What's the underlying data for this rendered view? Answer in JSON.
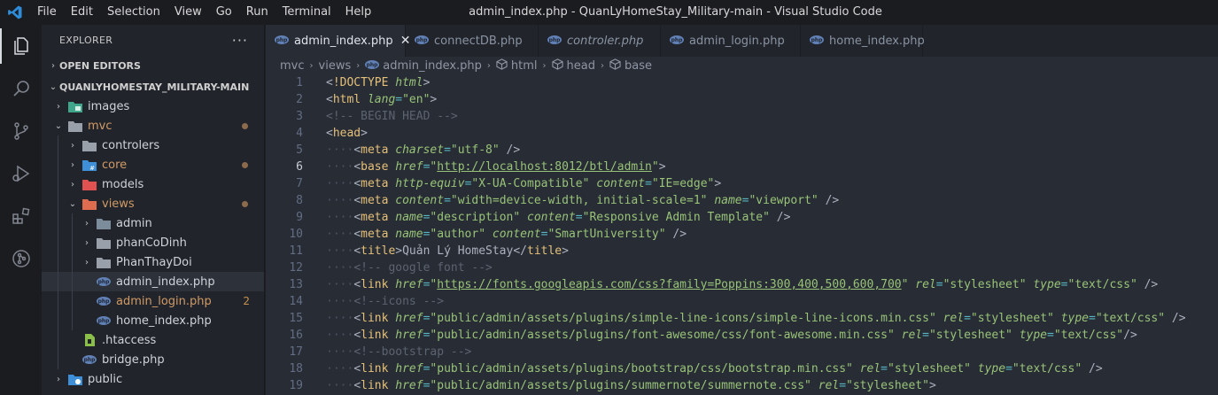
{
  "titlebar": {
    "menu": [
      "File",
      "Edit",
      "Selection",
      "View",
      "Go",
      "Run",
      "Terminal",
      "Help"
    ],
    "title": "admin_index.php - QuanLyHomeStay_Military-main - Visual Studio Code"
  },
  "activitybar": [
    "explorer-icon",
    "search-icon",
    "source-control-icon",
    "run-debug-icon",
    "extensions-icon",
    "git-graph-icon"
  ],
  "sidebar": {
    "title": "EXPLORER",
    "more": "···",
    "open_editors": "OPEN EDITORS",
    "root": "QUANLYHOMESTAY_MILITARY-MAIN",
    "tree": [
      {
        "label": "images",
        "type": "folder-images",
        "depth": 0,
        "chev": "›"
      },
      {
        "label": "mvc",
        "type": "folder-open",
        "depth": 0,
        "chev": "⌄",
        "status": "dot"
      },
      {
        "label": "controlers",
        "type": "folder",
        "depth": 1,
        "chev": "›"
      },
      {
        "label": "core",
        "type": "folder-core",
        "depth": 1,
        "chev": "›",
        "status": "dot"
      },
      {
        "label": "models",
        "type": "folder-models",
        "depth": 1,
        "chev": "›"
      },
      {
        "label": "views",
        "type": "folder-views",
        "depth": 1,
        "chev": "⌄",
        "status": "dot"
      },
      {
        "label": "admin",
        "type": "folder-admin",
        "depth": 2,
        "chev": "›"
      },
      {
        "label": "phanCoDinh",
        "type": "folder",
        "depth": 2,
        "chev": "›"
      },
      {
        "label": "PhanThayDoi",
        "type": "folder",
        "depth": 2,
        "chev": "›"
      },
      {
        "label": "admin_index.php",
        "type": "php",
        "depth": 2,
        "chev": "",
        "selected": true
      },
      {
        "label": "admin_login.php",
        "type": "php",
        "depth": 2,
        "chev": "",
        "status": "2"
      },
      {
        "label": "home_index.php",
        "type": "php",
        "depth": 2,
        "chev": "",
        "dim": true
      },
      {
        "label": ".htaccess",
        "type": "htaccess",
        "depth": 1,
        "chev": ""
      },
      {
        "label": "bridge.php",
        "type": "php",
        "depth": 1,
        "chev": ""
      },
      {
        "label": "public",
        "type": "folder-public",
        "depth": 0,
        "chev": "›"
      }
    ]
  },
  "tabs": [
    {
      "label": "admin_index.php",
      "active": true,
      "close": "✕"
    },
    {
      "label": "connectDB.php"
    },
    {
      "label": "controler.php",
      "italic": true
    },
    {
      "label": "admin_login.php"
    },
    {
      "label": "home_index.php"
    }
  ],
  "breadcrumb": [
    "mvc",
    "views",
    "admin_index.php",
    "html",
    "head",
    "base"
  ],
  "code": [
    {
      "n": "1",
      "tokens": [
        [
          "pct",
          "<"
        ],
        [
          "dt",
          "!DOCTYPE"
        ],
        [
          "pct",
          " "
        ],
        [
          "attr",
          "html"
        ],
        [
          "pct",
          ">"
        ]
      ]
    },
    {
      "n": "2",
      "tokens": [
        [
          "pct",
          "<"
        ],
        [
          "tag",
          "html"
        ],
        [
          "pct",
          " "
        ],
        [
          "attr",
          "lang"
        ],
        [
          "eq",
          "="
        ],
        [
          "str",
          "\"en\""
        ],
        [
          "pct",
          ">"
        ]
      ]
    },
    {
      "n": "3",
      "tokens": [
        [
          "com",
          "<!-- BEGIN HEAD -->"
        ]
      ]
    },
    {
      "n": "4",
      "tokens": [
        [
          "pct",
          "<"
        ],
        [
          "tag",
          "head"
        ],
        [
          "pct",
          ">"
        ]
      ]
    },
    {
      "n": "5",
      "indent": 1,
      "tokens": [
        [
          "pct",
          "<"
        ],
        [
          "tag",
          "meta"
        ],
        [
          "pct",
          " "
        ],
        [
          "attr",
          "charset"
        ],
        [
          "eq",
          "="
        ],
        [
          "str",
          "\"utf-8\""
        ],
        [
          "pct",
          " />"
        ]
      ]
    },
    {
      "n": "6",
      "indent": 1,
      "cur": true,
      "tokens": [
        [
          "pct",
          "<"
        ],
        [
          "tag",
          "base"
        ],
        [
          "pct",
          " "
        ],
        [
          "attr",
          "href"
        ],
        [
          "eq",
          "="
        ],
        [
          "str",
          "\""
        ],
        [
          "url",
          "http://localhost:8012/btl/admin"
        ],
        [
          "str",
          "\""
        ],
        [
          "pct",
          ">"
        ]
      ]
    },
    {
      "n": "7",
      "indent": 1,
      "tokens": [
        [
          "pct",
          "<"
        ],
        [
          "tag",
          "meta"
        ],
        [
          "pct",
          " "
        ],
        [
          "attr",
          "http-equiv"
        ],
        [
          "eq",
          "="
        ],
        [
          "str",
          "\"X-UA-Compatible\""
        ],
        [
          "pct",
          " "
        ],
        [
          "attr",
          "content"
        ],
        [
          "eq",
          "="
        ],
        [
          "str",
          "\"IE=edge\""
        ],
        [
          "pct",
          ">"
        ]
      ]
    },
    {
      "n": "8",
      "indent": 1,
      "tokens": [
        [
          "pct",
          "<"
        ],
        [
          "tag",
          "meta"
        ],
        [
          "pct",
          " "
        ],
        [
          "attr",
          "content"
        ],
        [
          "eq",
          "="
        ],
        [
          "str",
          "\"width=device-width, initial-scale=1\""
        ],
        [
          "pct",
          " "
        ],
        [
          "attr",
          "name"
        ],
        [
          "eq",
          "="
        ],
        [
          "str",
          "\"viewport\""
        ],
        [
          "pct",
          " />"
        ]
      ]
    },
    {
      "n": "9",
      "indent": 1,
      "tokens": [
        [
          "pct",
          "<"
        ],
        [
          "tag",
          "meta"
        ],
        [
          "pct",
          " "
        ],
        [
          "attr",
          "name"
        ],
        [
          "eq",
          "="
        ],
        [
          "str",
          "\"description\""
        ],
        [
          "pct",
          " "
        ],
        [
          "attr",
          "content"
        ],
        [
          "eq",
          "="
        ],
        [
          "str",
          "\"Responsive Admin Template\""
        ],
        [
          "pct",
          " />"
        ]
      ]
    },
    {
      "n": "10",
      "indent": 1,
      "tokens": [
        [
          "pct",
          "<"
        ],
        [
          "tag",
          "meta"
        ],
        [
          "pct",
          " "
        ],
        [
          "attr",
          "name"
        ],
        [
          "eq",
          "="
        ],
        [
          "str",
          "\"author\""
        ],
        [
          "pct",
          " "
        ],
        [
          "attr",
          "content"
        ],
        [
          "eq",
          "="
        ],
        [
          "str",
          "\"SmartUniversity\""
        ],
        [
          "pct",
          " />"
        ]
      ]
    },
    {
      "n": "11",
      "indent": 1,
      "tokens": [
        [
          "pct",
          "<"
        ],
        [
          "tag",
          "title"
        ],
        [
          "pct",
          ">Quản Lý HomeStay</"
        ],
        [
          "tag",
          "title"
        ],
        [
          "pct",
          ">"
        ]
      ]
    },
    {
      "n": "12",
      "indent": 1,
      "tokens": [
        [
          "com",
          "<!-- google font -->"
        ]
      ]
    },
    {
      "n": "13",
      "indent": 1,
      "tokens": [
        [
          "pct",
          "<"
        ],
        [
          "tag",
          "link"
        ],
        [
          "pct",
          " "
        ],
        [
          "attr",
          "href"
        ],
        [
          "eq",
          "="
        ],
        [
          "str",
          "\""
        ],
        [
          "url",
          "https://fonts.googleapis.com/css?family=Poppins:300,400,500,600,700"
        ],
        [
          "str",
          "\""
        ],
        [
          "pct",
          " "
        ],
        [
          "attr",
          "rel"
        ],
        [
          "eq",
          "="
        ],
        [
          "str",
          "\"stylesheet\""
        ],
        [
          "pct",
          " "
        ],
        [
          "attr",
          "type"
        ],
        [
          "eq",
          "="
        ],
        [
          "str",
          "\"text/css\""
        ],
        [
          "pct",
          " />"
        ]
      ]
    },
    {
      "n": "14",
      "indent": 1,
      "tokens": [
        [
          "com",
          "<!--icons -->"
        ]
      ]
    },
    {
      "n": "15",
      "indent": 1,
      "tokens": [
        [
          "pct",
          "<"
        ],
        [
          "tag",
          "link"
        ],
        [
          "pct",
          " "
        ],
        [
          "attr",
          "href"
        ],
        [
          "eq",
          "="
        ],
        [
          "str",
          "\"public/admin/assets/plugins/simple-line-icons/simple-line-icons.min.css\""
        ],
        [
          "pct",
          " "
        ],
        [
          "attr",
          "rel"
        ],
        [
          "eq",
          "="
        ],
        [
          "str",
          "\"stylesheet\""
        ],
        [
          "pct",
          " "
        ],
        [
          "attr",
          "type"
        ],
        [
          "eq",
          "="
        ],
        [
          "str",
          "\"text/css\""
        ],
        [
          "pct",
          " />"
        ]
      ]
    },
    {
      "n": "16",
      "indent": 1,
      "tokens": [
        [
          "pct",
          "<"
        ],
        [
          "tag",
          "link"
        ],
        [
          "pct",
          " "
        ],
        [
          "attr",
          "href"
        ],
        [
          "eq",
          "="
        ],
        [
          "str",
          "\"public/admin/assets/plugins/font-awesome/css/font-awesome.min.css\""
        ],
        [
          "pct",
          " "
        ],
        [
          "attr",
          "rel"
        ],
        [
          "eq",
          "="
        ],
        [
          "str",
          "\"stylesheet\""
        ],
        [
          "pct",
          " "
        ],
        [
          "attr",
          "type"
        ],
        [
          "eq",
          "="
        ],
        [
          "str",
          "\"text/css\""
        ],
        [
          "pct",
          "/>"
        ]
      ]
    },
    {
      "n": "17",
      "indent": 1,
      "tokens": [
        [
          "com",
          "<!--bootstrap -->"
        ]
      ]
    },
    {
      "n": "18",
      "indent": 1,
      "tokens": [
        [
          "pct",
          "<"
        ],
        [
          "tag",
          "link"
        ],
        [
          "pct",
          " "
        ],
        [
          "attr",
          "href"
        ],
        [
          "eq",
          "="
        ],
        [
          "str",
          "\"public/admin/assets/plugins/bootstrap/css/bootstrap.min.css\""
        ],
        [
          "pct",
          " "
        ],
        [
          "attr",
          "rel"
        ],
        [
          "eq",
          "="
        ],
        [
          "str",
          "\"stylesheet\""
        ],
        [
          "pct",
          " "
        ],
        [
          "attr",
          "type"
        ],
        [
          "eq",
          "="
        ],
        [
          "str",
          "\"text/css\""
        ],
        [
          "pct",
          " />"
        ]
      ]
    },
    {
      "n": "19",
      "indent": 1,
      "tokens": [
        [
          "pct",
          "<"
        ],
        [
          "tag",
          "link"
        ],
        [
          "pct",
          " "
        ],
        [
          "attr",
          "href"
        ],
        [
          "eq",
          "="
        ],
        [
          "str",
          "\"public/admin/assets/plugins/summernote/summernote.css\""
        ],
        [
          "pct",
          " "
        ],
        [
          "attr",
          "rel"
        ],
        [
          "eq",
          "="
        ],
        [
          "str",
          "\"stylesheet\""
        ],
        [
          "pct",
          ">"
        ]
      ]
    }
  ]
}
